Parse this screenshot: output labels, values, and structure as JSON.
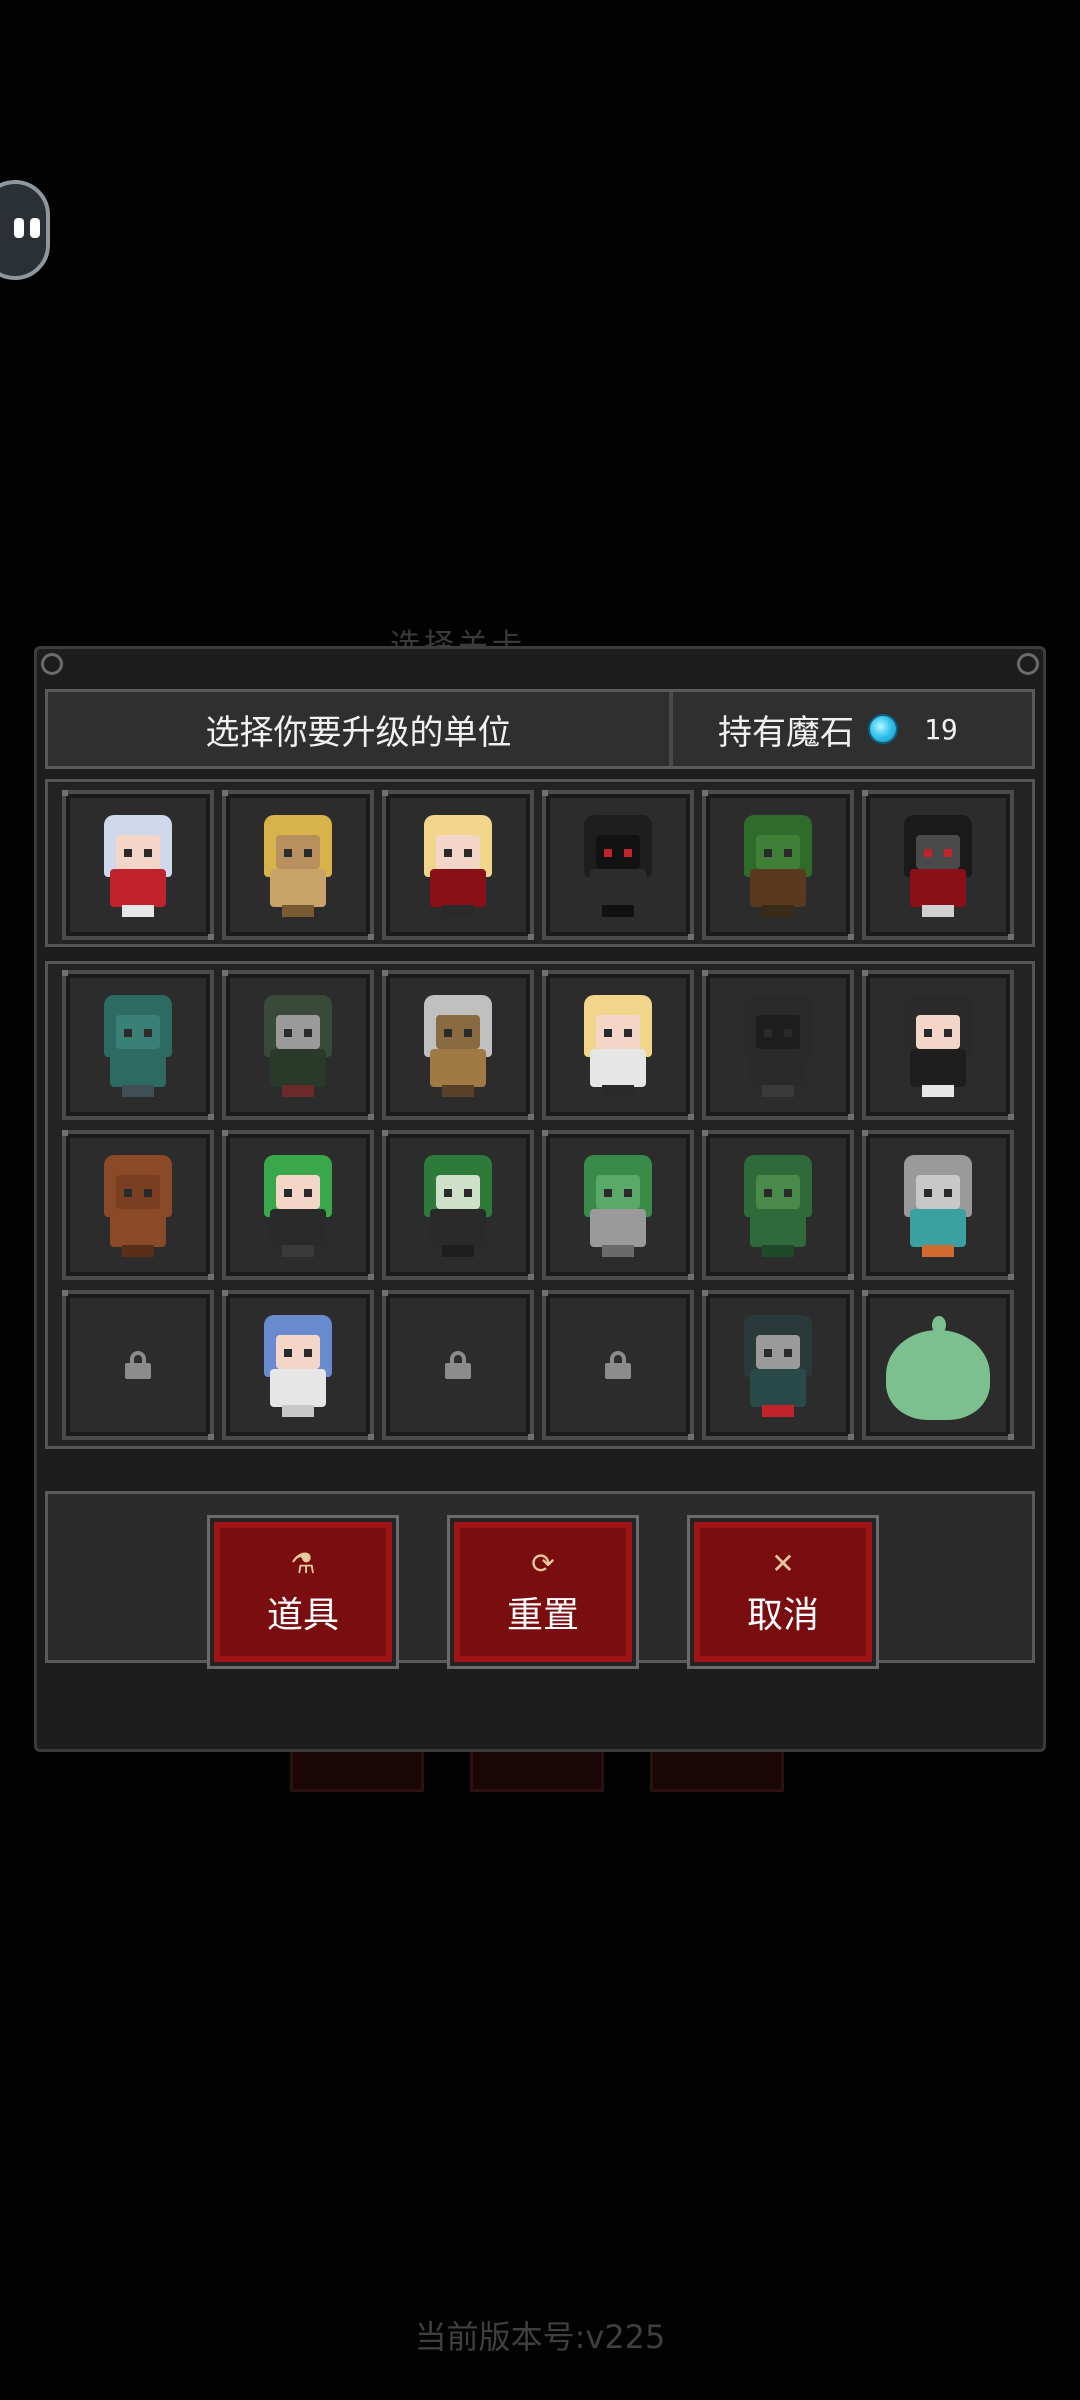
{
  "background_title": "选择关卡",
  "dialog": {
    "header_prompt": "选择你要升级的单位",
    "gems_label": "持有魔石",
    "gems_count": "19"
  },
  "top_units": [
    {
      "name": "white-haired-princess"
    },
    {
      "name": "pharaoh"
    },
    {
      "name": "vampire-girl"
    },
    {
      "name": "shadow-reaper"
    },
    {
      "name": "treant"
    },
    {
      "name": "dark-wizard"
    }
  ],
  "unit_rows": [
    [
      {
        "name": "zombie",
        "locked": false
      },
      {
        "name": "tribal-mask",
        "locked": false
      },
      {
        "name": "minotaur",
        "locked": false
      },
      {
        "name": "elf-girl",
        "locked": false
      },
      {
        "name": "gargoyle",
        "locked": false
      },
      {
        "name": "nun",
        "locked": false
      }
    ],
    [
      {
        "name": "rock-golem",
        "locked": false
      },
      {
        "name": "medusa",
        "locked": false
      },
      {
        "name": "frankenstein",
        "locked": false
      },
      {
        "name": "plant-monster",
        "locked": false
      },
      {
        "name": "green-dragon",
        "locked": false
      },
      {
        "name": "robot",
        "locked": false
      }
    ],
    [
      {
        "name": "locked-slot",
        "locked": true
      },
      {
        "name": "valkyrie",
        "locked": false
      },
      {
        "name": "locked-slot",
        "locked": true
      },
      {
        "name": "locked-slot",
        "locked": true
      },
      {
        "name": "goblin-shaman",
        "locked": false
      },
      {
        "name": "slime",
        "locked": false
      }
    ]
  ],
  "actions": [
    {
      "icon": "flask-icon",
      "glyph": "⚗",
      "label": "道具"
    },
    {
      "icon": "refresh-icon",
      "glyph": "⟳",
      "label": "重置"
    },
    {
      "icon": "close-icon",
      "glyph": "✕",
      "label": "取消"
    }
  ],
  "version": "当前版本号:v225",
  "colors": {
    "background": "#020202",
    "button_red": "#7a0d10",
    "gem": "#38c6f0"
  }
}
